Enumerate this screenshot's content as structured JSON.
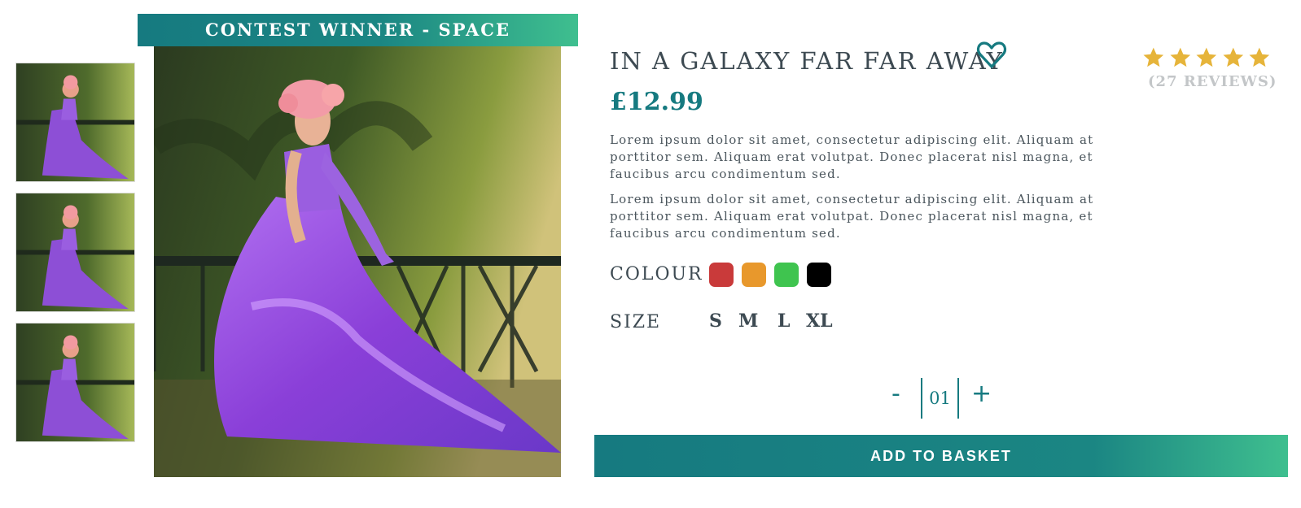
{
  "banner": {
    "text": "CONTEST WINNER - SPACE"
  },
  "product": {
    "title": "IN A GALAXY FAR FAR AWAY",
    "price": "£12.99",
    "rating": 5,
    "reviews": "(27 REVIEWS)",
    "descriptions": [
      "Lorem ipsum dolor sit amet, consectetur adipiscing elit. Aliquam at porttitor sem.  Aliquam erat volutpat. Donec placerat nisl magna, et faucibus arcu condimentum sed.",
      "Lorem ipsum dolor sit amet, consectetur adipiscing elit. Aliquam at porttitor sem.  Aliquam erat volutpat. Donec placerat nisl magna, et faucibus arcu condimentum sed."
    ]
  },
  "colour": {
    "label": "COLOUR",
    "options": [
      "#c93a3a",
      "#e8982c",
      "#3fc44f",
      "#000000"
    ]
  },
  "size": {
    "label": "SIZE",
    "options": [
      "S",
      "M",
      "L",
      "XL"
    ]
  },
  "quantity": {
    "minus": "-",
    "value": "01",
    "plus": "+"
  },
  "basket": {
    "label": "ADD TO BASKET"
  },
  "icons": {
    "favourite": "heart-icon",
    "star": "star-icon"
  },
  "colors": {
    "accent": "#167a80",
    "accent_light": "#3fbf8f",
    "star": "#e6b43a",
    "text": "#3d4a52"
  }
}
